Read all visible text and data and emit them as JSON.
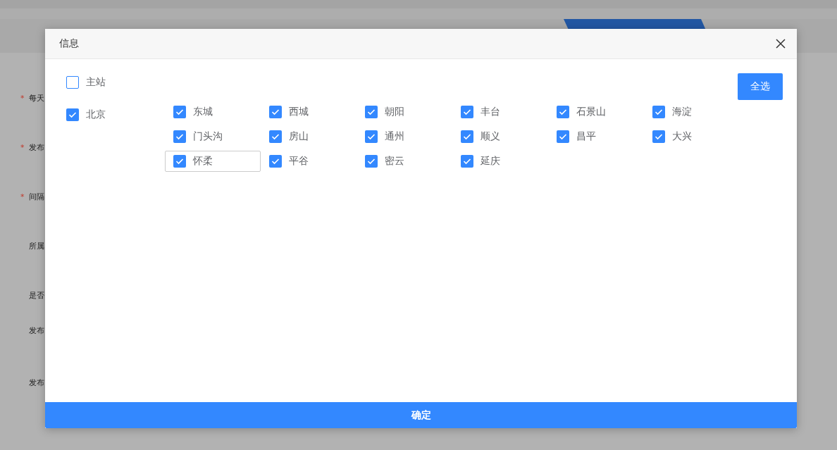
{
  "background": {
    "form_labels": [
      {
        "marker": "*",
        "text": "每天"
      },
      {
        "marker": "*",
        "text": "发布"
      },
      {
        "marker": "*",
        "text": "间隔"
      },
      {
        "text": "所属"
      },
      {
        "text": "是否"
      },
      {
        "text": "发布"
      },
      {
        "text": "发布"
      }
    ]
  },
  "dialog": {
    "title": "信息",
    "select_all_button": "全选",
    "main_station": {
      "label": "主站",
      "checked": false
    },
    "city": {
      "label": "北京",
      "checked": true,
      "districts": [
        {
          "label": "东城",
          "checked": true,
          "focused": false
        },
        {
          "label": "西城",
          "checked": true,
          "focused": false
        },
        {
          "label": "朝阳",
          "checked": true,
          "focused": false
        },
        {
          "label": "丰台",
          "checked": true,
          "focused": false
        },
        {
          "label": "石景山",
          "checked": true,
          "focused": false
        },
        {
          "label": "海淀",
          "checked": true,
          "focused": false
        },
        {
          "label": "门头沟",
          "checked": true,
          "focused": false
        },
        {
          "label": "房山",
          "checked": true,
          "focused": false
        },
        {
          "label": "通州",
          "checked": true,
          "focused": false
        },
        {
          "label": "顺义",
          "checked": true,
          "focused": false
        },
        {
          "label": "昌平",
          "checked": true,
          "focused": false
        },
        {
          "label": "大兴",
          "checked": true,
          "focused": false
        },
        {
          "label": "怀柔",
          "checked": true,
          "focused": true
        },
        {
          "label": "平谷",
          "checked": true,
          "focused": false
        },
        {
          "label": "密云",
          "checked": true,
          "focused": false
        },
        {
          "label": "延庆",
          "checked": true,
          "focused": false
        }
      ]
    },
    "confirm_button": "确定"
  }
}
